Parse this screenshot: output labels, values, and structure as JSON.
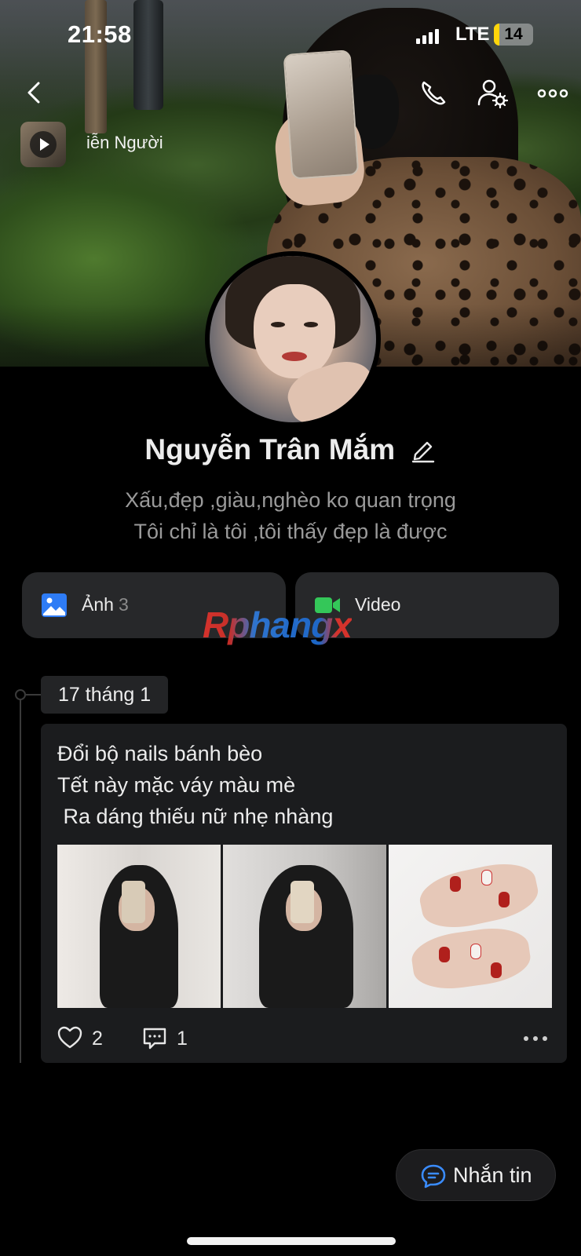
{
  "status_bar": {
    "time": "21:58",
    "network": "LTE",
    "battery": "14",
    "battery_level": 0.14,
    "battery_color": "#ffd60a"
  },
  "header": {
    "icons": [
      "back-arrow-icon",
      "phone-icon",
      "friend-settings-icon",
      "more-icon"
    ],
    "music": {
      "title": "iễn Người"
    }
  },
  "profile": {
    "name": "Nguyễn Trân Mắm",
    "bio_line1": "Xấu,đẹp ,giàu,nghèo ko quan trọng",
    "bio_line2": "Tôi chỉ là tôi ,tôi thấy đẹp là được"
  },
  "media": {
    "photos": {
      "label": "Ảnh",
      "count": "3",
      "icon": "image-icon",
      "color": "#2e7cf6"
    },
    "video": {
      "label": "Video",
      "icon": "video-icon",
      "color": "#34c759"
    }
  },
  "watermark": "Rphangx",
  "timeline": {
    "date": "17 tháng 1",
    "post": {
      "text": "Đổi bộ nails bánh bèo\nTết này mặc váy màu mè\n Ra dáng thiếu nữ nhẹ nhàng",
      "likes": "2",
      "comments": "1"
    }
  },
  "actions": {
    "message_label": "Nhắn tin",
    "accent": "#3a8cff"
  }
}
